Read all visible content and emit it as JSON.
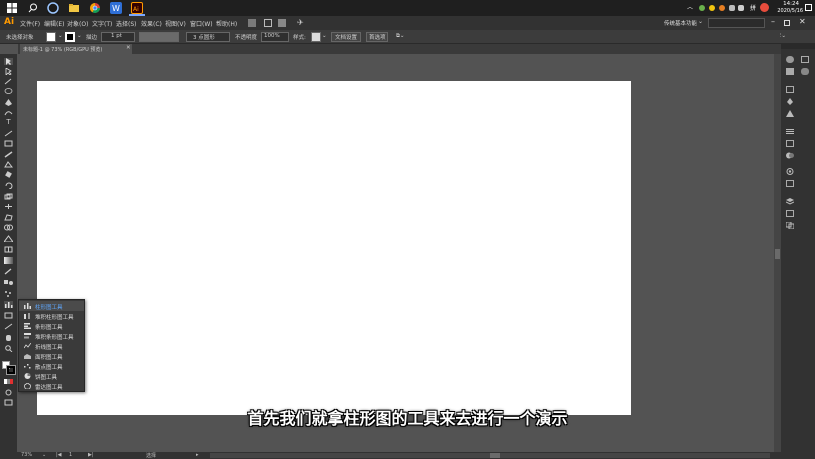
{
  "taskbar": {
    "ime_label": "拼",
    "time": "14:24",
    "date": "2020/5/16",
    "workspace": "传统基本功能"
  },
  "app": {
    "logo": "Ai"
  },
  "menu": [
    "文件(F)",
    "编辑(E)",
    "对象(O)",
    "文字(T)",
    "选择(S)",
    "效果(C)",
    "视图(V)",
    "窗口(W)",
    "帮助(H)"
  ],
  "controlbar": {
    "no_selection": "未选择对象",
    "stroke_label": "描边",
    "stroke_value": "1 pt",
    "brush": "3 点圆形",
    "opacity_label": "不透明度",
    "opacity_value": "100%",
    "style_label": "样式:",
    "doc_setup": "文档设置",
    "prefs": "首选项"
  },
  "document": {
    "tab_title": "未标题-1 @ 73% (RGB/GPU 预览)"
  },
  "flyout": {
    "items": [
      {
        "label": "柱形图工具",
        "selected": true
      },
      {
        "label": "堆积柱形图工具"
      },
      {
        "label": "条形图工具"
      },
      {
        "label": "堆积条形图工具"
      },
      {
        "label": "折线图工具"
      },
      {
        "label": "面积图工具"
      },
      {
        "label": "散点图工具"
      },
      {
        "label": "饼图工具"
      },
      {
        "label": "雷达图工具"
      }
    ]
  },
  "statusbar": {
    "zoom": "73%",
    "page": "1",
    "tool": "选择"
  },
  "subtitle": "首先我们就拿柱形图的工具来去进行一个演示",
  "colors": {
    "accent": "#5fa8ff",
    "ai_orange": "#ff9a00",
    "artboard": "#ffffff"
  }
}
